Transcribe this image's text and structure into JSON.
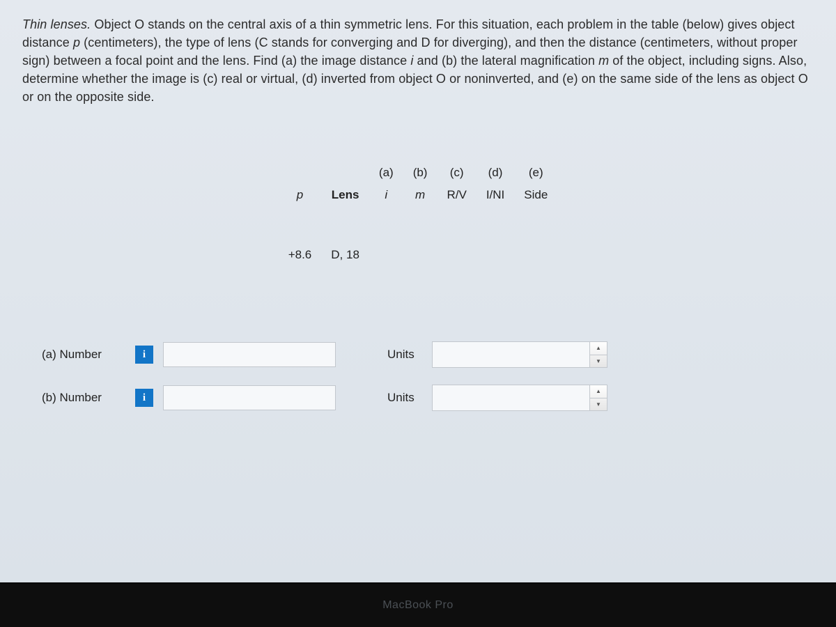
{
  "prompt": {
    "lead_italic": "Thin lenses.",
    "body": " Object O stands on the central axis of a thin symmetric lens. For this situation, each problem in the table (below) gives object distance ",
    "p_sym": "p",
    "body2": " (centimeters), the type of lens (C stands for converging and D for diverging), and then the distance (centimeters, without proper sign) between a focal point and the lens. Find (a) the image distance ",
    "i_sym": "i",
    "body3": " and (b) the lateral magnification ",
    "m_sym": "m",
    "body4": " of the object, including signs. Also, determine whether the image is (c) real or virtual, (d) inverted from object O or noninverted, and (e) on the same side of the lens as object O or on the opposite side."
  },
  "table": {
    "super_headers": [
      "",
      "",
      "(a)",
      "(b)",
      "(c)",
      "(d)",
      "(e)"
    ],
    "headers": [
      "p",
      "Lens",
      "i",
      "m",
      "R/V",
      "I/NI",
      "Side"
    ],
    "row": [
      "+8.6",
      "D, 18",
      "",
      "",
      "",
      "",
      ""
    ]
  },
  "inputs": {
    "a": {
      "label": "(a)   Number",
      "info": "i",
      "value": "",
      "units_label": "Units",
      "units_value": ""
    },
    "b": {
      "label": "(b)   Number",
      "info": "i",
      "value": "",
      "units_label": "Units",
      "units_value": ""
    }
  },
  "device": {
    "brand": "MacBook Pro"
  }
}
